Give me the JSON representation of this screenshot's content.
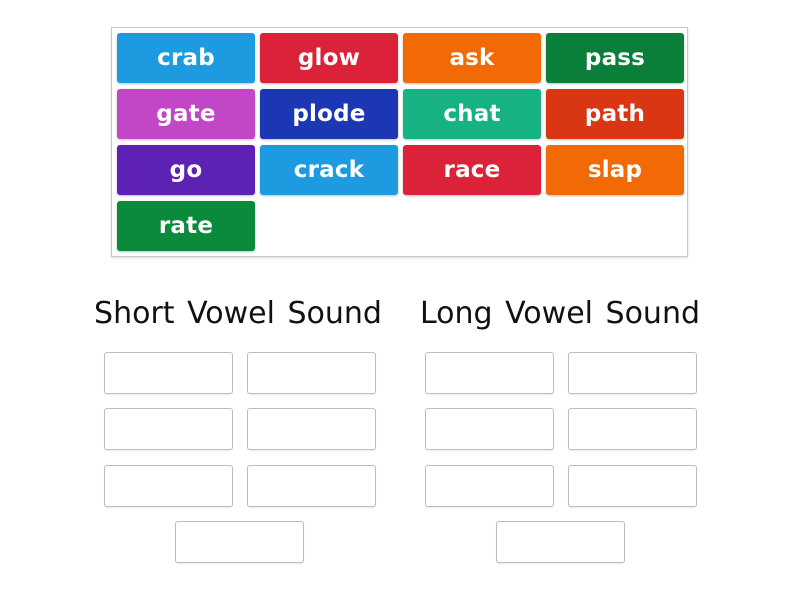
{
  "word_bank": {
    "tiles": [
      {
        "label": "crab",
        "color": "#1e9be0"
      },
      {
        "label": "glow",
        "color": "#dc2238"
      },
      {
        "label": "ask",
        "color": "#f26a05"
      },
      {
        "label": "pass",
        "color": "#0a7f3a"
      },
      {
        "label": "gate",
        "color": "#c247c6"
      },
      {
        "label": "plode",
        "color": "#1c37b4"
      },
      {
        "label": "chat",
        "color": "#17b283"
      },
      {
        "label": "path",
        "color": "#d93613"
      },
      {
        "label": "go",
        "color": "#5d22b3"
      },
      {
        "label": "crack",
        "color": "#1e9be0"
      },
      {
        "label": "race",
        "color": "#dc2238"
      },
      {
        "label": "slap",
        "color": "#f26a05"
      },
      {
        "label": "rate",
        "color": "#0a8a3a"
      }
    ]
  },
  "groups": [
    {
      "title": "Short Vowel Sound",
      "slot_count": 7
    },
    {
      "title": "Long Vowel Sound",
      "slot_count": 7
    }
  ]
}
